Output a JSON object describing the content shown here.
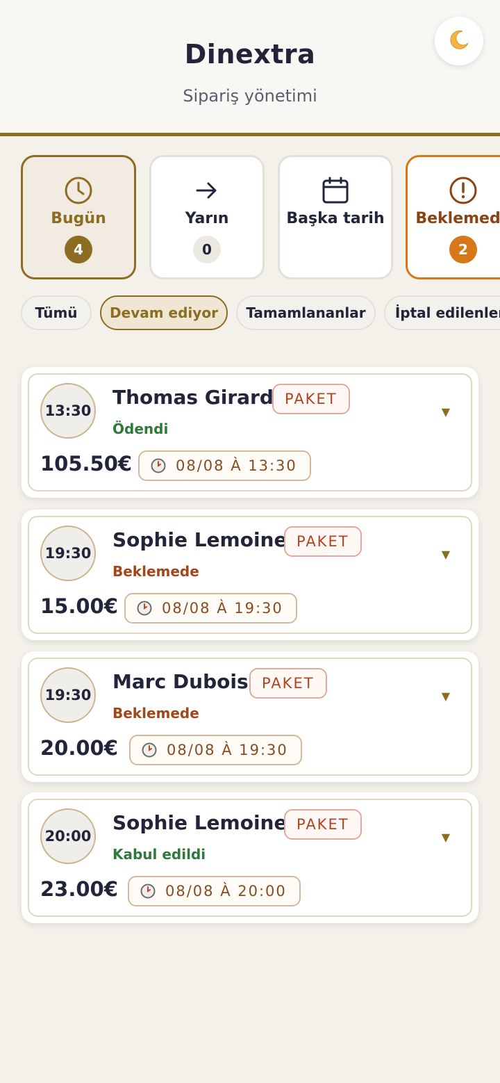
{
  "header": {
    "title": "Dinextra",
    "subtitle": "Sipariş yönetimi",
    "theme_icon": "moon-icon"
  },
  "tabs": [
    {
      "label": "Bugün",
      "count": "4",
      "icon": "clock-icon",
      "state": "active"
    },
    {
      "label": "Yarın",
      "count": "0",
      "icon": "arrow-right-icon",
      "state": "plain"
    },
    {
      "label": "Başka tarih",
      "count": "",
      "icon": "calendar-icon",
      "state": "plain"
    },
    {
      "label": "Beklemede",
      "count": "2",
      "icon": "alert-circle-icon",
      "state": "warn"
    }
  ],
  "filters": [
    {
      "label": "Tümü",
      "active": false
    },
    {
      "label": "Devam ediyor",
      "active": true
    },
    {
      "label": "Tamamlananlar",
      "active": false
    },
    {
      "label": "İptal edilenler",
      "active": false
    }
  ],
  "orders": [
    {
      "time": "13:30",
      "name": "Thomas Girard",
      "type": "PAKET",
      "status": "Ödendi",
      "status_color": "#2f7a3a",
      "price": "105.50€",
      "datetime": "08/08 À 13:30"
    },
    {
      "time": "19:30",
      "name": "Sophie Lemoine",
      "type": "PAKET",
      "status": "Beklemede",
      "status_color": "#a0481a",
      "price": "15.00€",
      "datetime": "08/08 À 19:30"
    },
    {
      "time": "19:30",
      "name": "Marc Dubois",
      "type": "PAKET",
      "status": "Beklemede",
      "status_color": "#a0481a",
      "price": "20.00€",
      "datetime": "08/08 À 19:30"
    },
    {
      "time": "20:00",
      "name": "Sophie Lemoine",
      "type": "PAKET",
      "status": "Kabul edildi",
      "status_color": "#2f7a3a",
      "price": "23.00€",
      "datetime": "08/08 À 20:00"
    }
  ],
  "colors": {
    "accent": "#8c6d22",
    "warning": "#d6781a",
    "success": "#2f7a3a",
    "pending": "#a0481a",
    "background": "#f4f1ea"
  }
}
